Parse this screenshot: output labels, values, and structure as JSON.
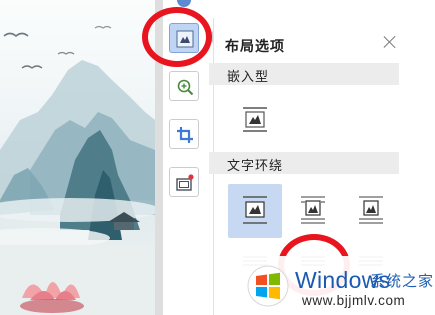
{
  "panel": {
    "title": "布局选项",
    "inline_section": "嵌入型",
    "wrap_section": "文字环绕"
  },
  "toolbar": {
    "tools": [
      {
        "icon": "layout-options-icon",
        "active": true
      },
      {
        "icon": "zoom-icon",
        "active": false
      },
      {
        "icon": "crop-icon",
        "active": false
      },
      {
        "icon": "picture-frame-icon",
        "active": false
      }
    ]
  },
  "watermark": {
    "brand": "Windows",
    "subtitle": "系统之家",
    "url": "www.bjjmlv.com"
  },
  "colors": {
    "highlight_ring": "#e8141e",
    "selected_option": "#c7d8f3",
    "watermark_blue": "#1c5ab1"
  }
}
